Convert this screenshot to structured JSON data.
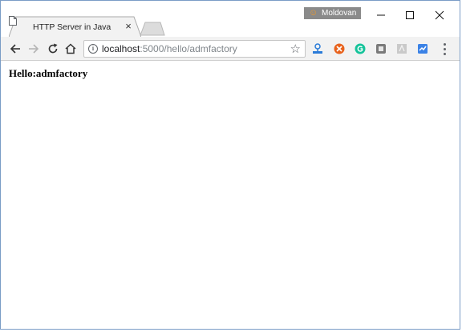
{
  "window": {
    "profile_name": "Moldovan",
    "controls": {
      "minimize": "minimize",
      "maximize": "maximize",
      "close": "close"
    }
  },
  "tab": {
    "title": "HTTP Server in Java",
    "close_glyph": "×",
    "icon": "document-icon"
  },
  "toolbar": {
    "url_host": "localhost",
    "url_path": ":5000/hello/admfactory",
    "star_glyph": "☆",
    "info_glyph": "i"
  },
  "extensions": [
    {
      "name": "download-ext-icon",
      "color": "#2a7bd8"
    },
    {
      "name": "orange-ext-icon",
      "color": "#e8621c"
    },
    {
      "name": "grammarly-ext-icon",
      "color": "#15c39a"
    },
    {
      "name": "gray-ext-icon",
      "color": "#7a7a7a"
    },
    {
      "name": "pdf-ext-icon",
      "color": "#c9c9c9"
    },
    {
      "name": "analytics-ext-icon",
      "color": "#3b82e6"
    }
  ],
  "page": {
    "heading": "Hello:admfactory"
  }
}
